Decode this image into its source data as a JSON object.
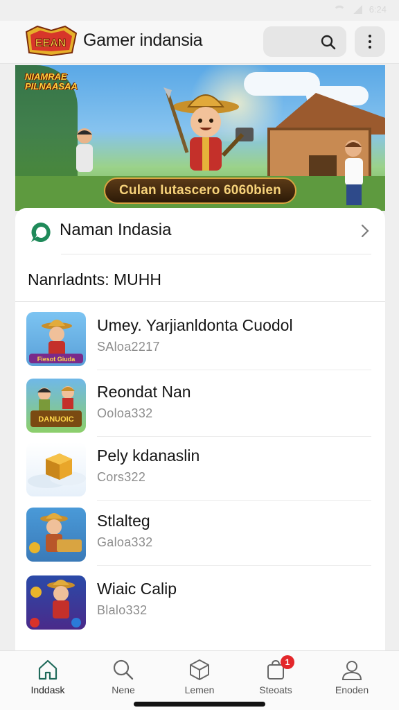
{
  "status_bar": {
    "time": "6:24"
  },
  "app": {
    "logo_text": "EEAN",
    "title": "Gamer indansia"
  },
  "hero": {
    "logo_text": "NIAMRAE PILNAASAA",
    "cta": "Culan Iutascero 6060bien"
  },
  "featured": {
    "label": "Naman Indasia"
  },
  "section": {
    "title": "Nanrladnts: MUHH"
  },
  "games": [
    {
      "title": "Umey. Yarjianldonta Cuodol",
      "sub": "SAloa2217",
      "thumb_label": "Fiesot Giuda"
    },
    {
      "title": "Reondat Nan",
      "sub": "Ooloa332",
      "thumb_label": "DANUOIC"
    },
    {
      "title": "Pely kdanaslin",
      "sub": "Cors322",
      "thumb_label": ""
    },
    {
      "title": "Stlalteg",
      "sub": "Galoa332",
      "thumb_label": ""
    },
    {
      "title": "Wiaic Calip",
      "sub": "Blalo332",
      "thumb_label": ""
    }
  ],
  "bottom_nav": [
    {
      "label": "Inddask",
      "icon": "home-icon"
    },
    {
      "label": "Nene",
      "icon": "search-icon"
    },
    {
      "label": "Lemen",
      "icon": "box-icon"
    },
    {
      "label": "Steoats",
      "icon": "bag-icon",
      "badge": "1"
    },
    {
      "label": "Enoden",
      "icon": "profile-icon"
    }
  ],
  "colors": {
    "accent": "#1f8a5a",
    "badge": "#e3262a",
    "cta_text": "#f6d27a"
  }
}
